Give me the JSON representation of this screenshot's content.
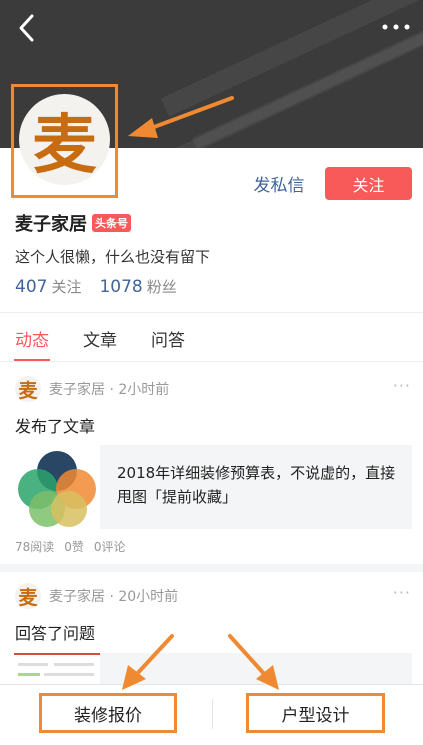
{
  "header": {
    "back_icon": "chevron-left-icon",
    "more_icon": "more-horizontal-icon"
  },
  "profile": {
    "avatar_char": "麦",
    "name": "麦子家居",
    "badge": "头条号",
    "bio": "这个人很懒，什么也没有留下",
    "following_count": "407",
    "following_label": "关注",
    "followers_count": "1078",
    "followers_label": "粉丝",
    "message_label": "发私信",
    "follow_label": "关注"
  },
  "tabs": [
    {
      "label": "动态",
      "active": true
    },
    {
      "label": "文章",
      "active": false
    },
    {
      "label": "问答",
      "active": false
    }
  ],
  "posts": [
    {
      "author": "麦子家居",
      "time": "2小时前",
      "action": "发布了文章",
      "article_title": "2018年详细装修预算表，不说虚的，直接甩图「提前收藏」",
      "reads": "78阅读",
      "likes": "0赞",
      "comments": "0评论"
    },
    {
      "author": "麦子家居",
      "time": "20小时前",
      "action": "回答了问题"
    }
  ],
  "bottom_bar": {
    "left_label": "装修报价",
    "right_label": "户型设计"
  },
  "colors": {
    "accent": "#f85959",
    "link": "#406599",
    "annotation": "#f08a32",
    "header_bg": "#3b3b3b"
  }
}
